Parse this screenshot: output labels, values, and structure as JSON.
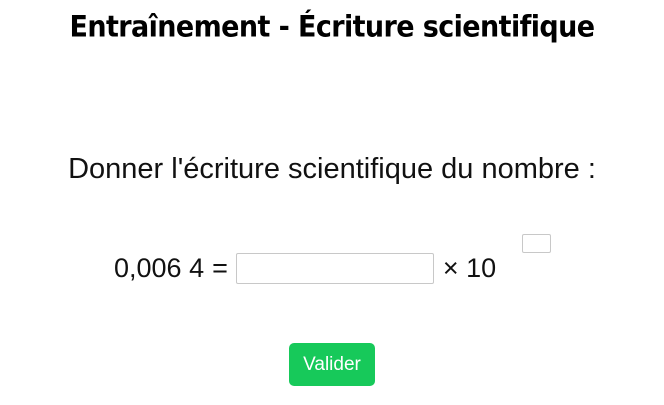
{
  "page": {
    "title": "Entraînement - Écriture scientifique"
  },
  "exercise": {
    "prompt": "Donner l'écriture scientifique du nombre :",
    "number": "0,006 4",
    "equals": "=",
    "mantissa_value": "",
    "times_ten": "× 10",
    "exponent_value": ""
  },
  "actions": {
    "validate_label": "Valider"
  },
  "colors": {
    "accent": "#17c95a",
    "input_border": "#c8c8c8"
  }
}
